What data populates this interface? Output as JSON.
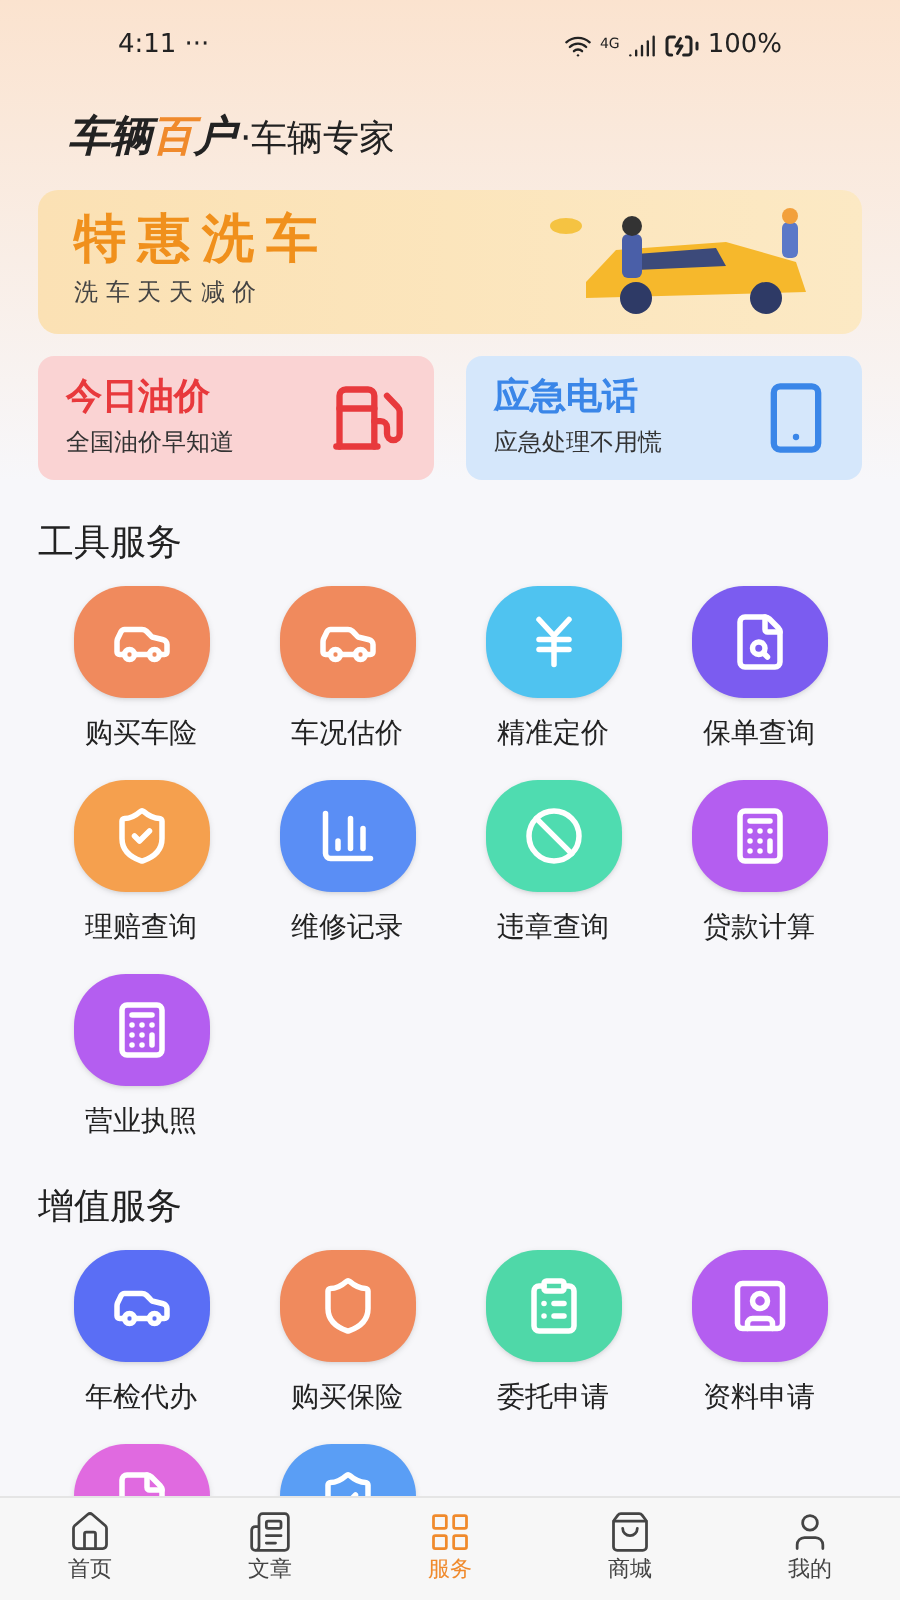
{
  "status_bar": {
    "time": "4:11",
    "more": "···",
    "network": "4G",
    "battery": "100%"
  },
  "header": {
    "brand_part1": "车辆",
    "brand_part2": "百",
    "brand_part3": "户",
    "slogan": "·车辆专家"
  },
  "banner": {
    "title": "特惠洗车",
    "subtitle": "洗 车 天 天 减 价"
  },
  "cards": [
    {
      "title": "今日油价",
      "subtitle": "全国油价早知道",
      "color": "#e8393c"
    },
    {
      "title": "应急电话",
      "subtitle": "应急处理不用慌",
      "color": "#3a86e8"
    }
  ],
  "sections": [
    {
      "title": "工具服务",
      "items": [
        {
          "label": "购买车险",
          "color": "#f08a5d"
        },
        {
          "label": "车况估价",
          "color": "#f08a5d"
        },
        {
          "label": "精准定价",
          "color": "#4fc3f0"
        },
        {
          "label": "保单查询",
          "color": "#7b5cf0"
        },
        {
          "label": "理赔查询",
          "color": "#f5a04e"
        },
        {
          "label": "维修记录",
          "color": "#5a8ef5"
        },
        {
          "label": "违章查询",
          "color": "#4fdcb0"
        },
        {
          "label": "贷款计算",
          "color": "#b45ef0"
        },
        {
          "label": "营业执照",
          "color": "#b45ef0"
        }
      ]
    },
    {
      "title": "增值服务",
      "items": [
        {
          "label": "年检代办",
          "color": "#5a6ef5"
        },
        {
          "label": "购买保险",
          "color": "#f08a5d"
        },
        {
          "label": "委托申请",
          "color": "#4fd8a8"
        },
        {
          "label": "资料申请",
          "color": "#b45ef0"
        },
        {
          "color": "#e06ae0"
        },
        {
          "color": "#5a9ef5"
        }
      ]
    }
  ],
  "nav": [
    {
      "label": "首页",
      "selected": false
    },
    {
      "label": "文章",
      "selected": false
    },
    {
      "label": "服务",
      "selected": true
    },
    {
      "label": "商城",
      "selected": false
    },
    {
      "label": "我的",
      "selected": false
    }
  ]
}
